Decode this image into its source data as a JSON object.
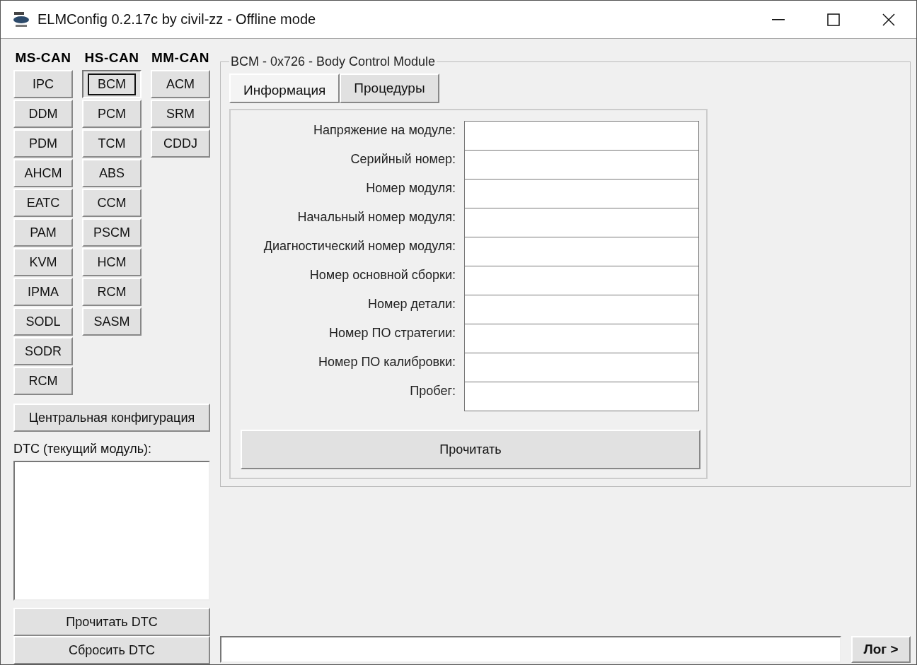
{
  "window": {
    "title": "ELMConfig 0.2.17c by civil-zz - Offline mode"
  },
  "buses": [
    {
      "label": "MS-CAN",
      "modules": [
        {
          "label": "IPC",
          "selected": false
        },
        {
          "label": "DDM",
          "selected": false
        },
        {
          "label": "PDM",
          "selected": false
        },
        {
          "label": "AHCM",
          "selected": false
        },
        {
          "label": "EATC",
          "selected": false
        },
        {
          "label": "PAM",
          "selected": false
        },
        {
          "label": "KVM",
          "selected": false
        },
        {
          "label": "IPMA",
          "selected": false
        },
        {
          "label": "SODL",
          "selected": false
        },
        {
          "label": "SODR",
          "selected": false
        },
        {
          "label": "RCM",
          "selected": false
        }
      ]
    },
    {
      "label": "HS-CAN",
      "modules": [
        {
          "label": "BCM",
          "selected": true
        },
        {
          "label": "PCM",
          "selected": false
        },
        {
          "label": "TCM",
          "selected": false
        },
        {
          "label": "ABS",
          "selected": false
        },
        {
          "label": "CCM",
          "selected": false
        },
        {
          "label": "PSCM",
          "selected": false
        },
        {
          "label": "HCM",
          "selected": false
        },
        {
          "label": "RCM",
          "selected": false
        },
        {
          "label": "SASM",
          "selected": false
        }
      ]
    },
    {
      "label": "MM-CAN",
      "modules": [
        {
          "label": "ACM",
          "selected": false
        },
        {
          "label": "SRM",
          "selected": false
        },
        {
          "label": "CDDJ",
          "selected": false
        }
      ]
    }
  ],
  "central_config_button": "Центральная конфигурация",
  "dtc": {
    "label": "DTC (текущий модуль):",
    "buttons": [
      "Прочитать DTC",
      "Сбросить DTC"
    ]
  },
  "module_group": {
    "title": "BCM - 0x726 - Body Control Module",
    "tabs": [
      {
        "label": "Информация",
        "selected": true
      },
      {
        "label": "Процедуры",
        "selected": false
      }
    ],
    "fields": [
      {
        "label": "Напряжение на модуле:"
      },
      {
        "label": "Серийный номер:"
      },
      {
        "label": "Номер модуля:"
      },
      {
        "label": "Начальный номер модуля:"
      },
      {
        "label": "Диагностический номер модуля:"
      },
      {
        "label": "Номер основной сборки:"
      },
      {
        "label": "Номер детали:"
      },
      {
        "label": "Номер ПО стратегии:"
      },
      {
        "label": "Номер ПО калибровки:"
      },
      {
        "label": "Пробег:"
      }
    ],
    "read_button": "Прочитать"
  },
  "log_button": "Лог >"
}
